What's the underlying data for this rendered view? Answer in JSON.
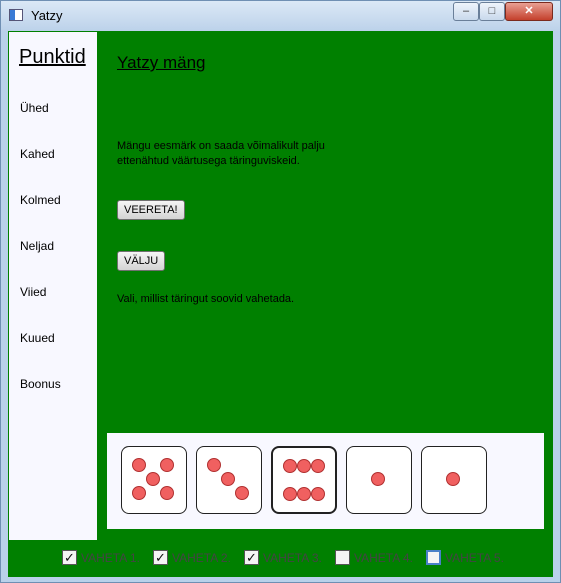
{
  "window": {
    "title": "Yatzy",
    "close_label": "✕",
    "min_label": "–",
    "max_label": "□"
  },
  "sidebar": {
    "title": "Punktid",
    "items": [
      {
        "label": "Ühed"
      },
      {
        "label": "Kahed"
      },
      {
        "label": "Kolmed"
      },
      {
        "label": "Neljad"
      },
      {
        "label": "Viied"
      },
      {
        "label": "Kuued"
      },
      {
        "label": "Boonus"
      }
    ]
  },
  "main": {
    "title": "Yatzy mäng",
    "goal_text": "Mängu eesmärk on saada võimalikult palju ettenähtud väärtusega täringuviskeid.",
    "roll_button": "VEERETA!",
    "exit_button": "VÄLJU",
    "choose_text": "Vali, millist täringut soovid vahetada."
  },
  "dice": [
    {
      "value": 5,
      "selected": false
    },
    {
      "value": 3,
      "selected": false
    },
    {
      "value": 6,
      "selected": true
    },
    {
      "value": 1,
      "selected": false
    },
    {
      "value": 1,
      "selected": false
    }
  ],
  "swap_checkboxes": [
    {
      "label": "VAHETA 1.",
      "checked": true
    },
    {
      "label": "VAHETA 2.",
      "checked": true
    },
    {
      "label": "VAHETA 3.",
      "checked": true
    },
    {
      "label": "VAHETA 4.",
      "checked": false
    },
    {
      "label": "VAHETA 5.",
      "checked": false,
      "focused": true
    }
  ],
  "colors": {
    "background": "#008000",
    "panel": "#f8f8ff",
    "pip": "#f06060"
  }
}
